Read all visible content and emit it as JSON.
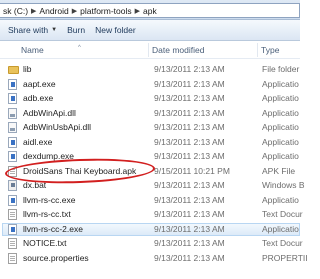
{
  "address_bar": {
    "segments": [
      "sk (C:)",
      "Android",
      "platform-tools",
      "apk"
    ]
  },
  "toolbar": {
    "share_label": "Share with",
    "burn_label": "Burn",
    "new_folder_label": "New folder"
  },
  "columns": {
    "name": "Name",
    "date": "Date modified",
    "type": "Type"
  },
  "files": [
    {
      "name": "lib",
      "date": "9/13/2011 2:13 AM",
      "type": "File folder",
      "icon": "folder-icon"
    },
    {
      "name": "aapt.exe",
      "date": "9/13/2011 2:13 AM",
      "type": "Applicatio",
      "icon": "exe-icon"
    },
    {
      "name": "adb.exe",
      "date": "9/13/2011 2:13 AM",
      "type": "Applicatio",
      "icon": "exe-icon"
    },
    {
      "name": "AdbWinApi.dll",
      "date": "9/13/2011 2:13 AM",
      "type": "Applicatio",
      "icon": "dll-icon"
    },
    {
      "name": "AdbWinUsbApi.dll",
      "date": "9/13/2011 2:13 AM",
      "type": "Applicatio",
      "icon": "dll-icon"
    },
    {
      "name": "aidl.exe",
      "date": "9/13/2011 2:13 AM",
      "type": "Applicatio",
      "icon": "exe-icon"
    },
    {
      "name": "dexdump.exe",
      "date": "9/13/2011 2:13 AM",
      "type": "Applicatio",
      "icon": "exe-icon"
    },
    {
      "name": "DroidSans Thai Keyboard.apk",
      "date": "9/15/2011 10:21 PM",
      "type": "APK File",
      "icon": "document-icon"
    },
    {
      "name": "dx.bat",
      "date": "9/13/2011 2:13 AM",
      "type": "Windows B",
      "icon": "batch-icon"
    },
    {
      "name": "llvm-rs-cc.exe",
      "date": "9/13/2011 2:13 AM",
      "type": "Applicatio",
      "icon": "exe-icon"
    },
    {
      "name": "llvm-rs-cc.txt",
      "date": "9/13/2011 2:13 AM",
      "type": "Text Docur",
      "icon": "document-icon"
    },
    {
      "name": "llvm-rs-cc-2.exe",
      "date": "9/13/2011 2:13 AM",
      "type": "Applicatio",
      "icon": "exe-icon"
    },
    {
      "name": "NOTICE.txt",
      "date": "9/13/2011 2:13 AM",
      "type": "Text Docur",
      "icon": "document-icon"
    },
    {
      "name": "source.properties",
      "date": "9/13/2011 2:13 AM",
      "type": "PROPERTII",
      "icon": "document-icon"
    }
  ],
  "colors": {
    "annotation": "#d21f1f",
    "selection": "#dceaf8"
  }
}
